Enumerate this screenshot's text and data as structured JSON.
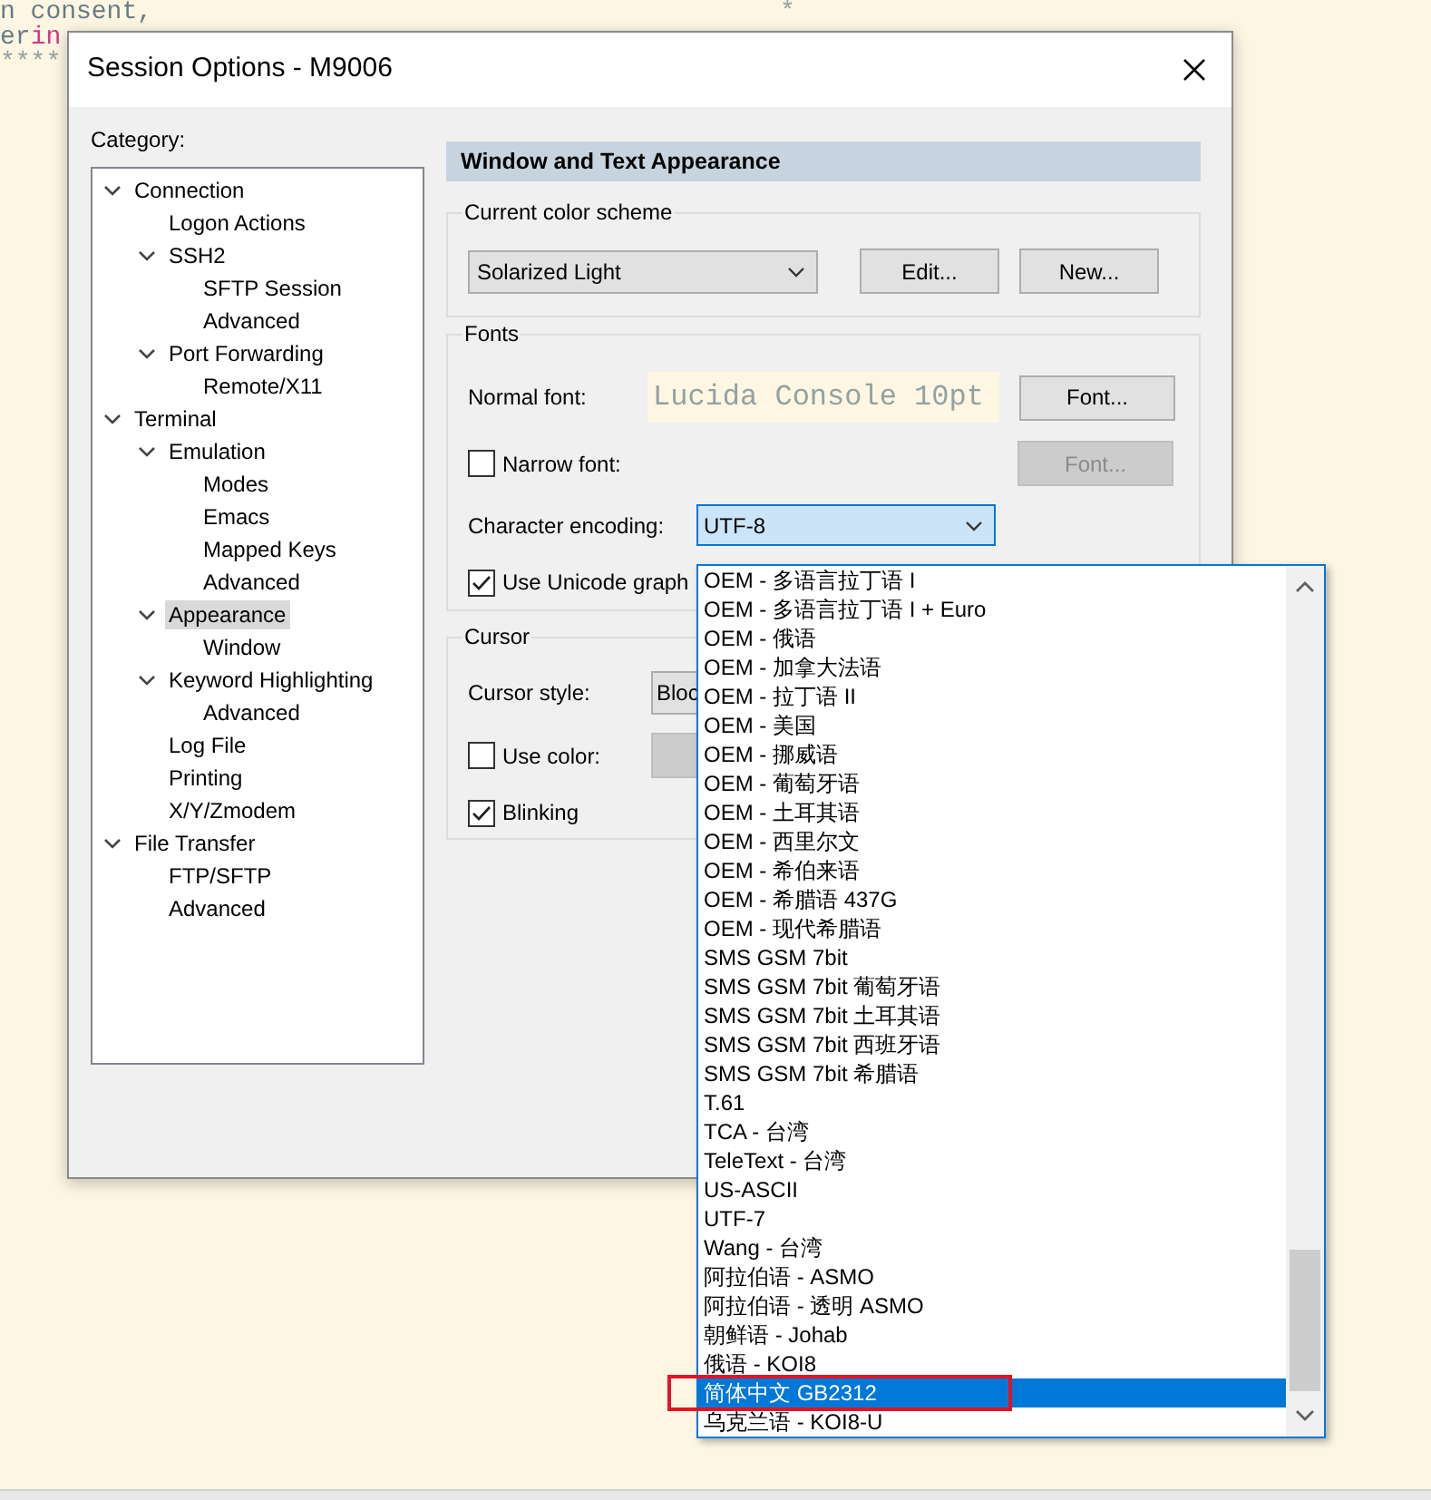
{
  "editor": {
    "lines": [
      {
        "segments": [
          {
            "text": "n consent,",
            "color": "#657b83"
          }
        ],
        "trail": "*"
      },
      {
        "segments": [
          {
            "text": "er",
            "color": "#657b83"
          },
          {
            "text": "in",
            "color": "#d33682"
          }
        ]
      },
      {
        "segments": [
          {
            "text": "****",
            "color": "#93a1a1"
          }
        ]
      }
    ]
  },
  "dialog": {
    "title": "Session Options - M9006"
  },
  "category_label": "Category:",
  "tree": [
    {
      "label": "Connection",
      "expanded": true,
      "selected": false,
      "children": [
        {
          "label": "Logon Actions",
          "selected": false
        },
        {
          "label": "SSH2",
          "expanded": true,
          "selected": false,
          "children": [
            {
              "label": "SFTP Session",
              "selected": false
            },
            {
              "label": "Advanced",
              "selected": false
            }
          ]
        },
        {
          "label": "Port Forwarding",
          "expanded": true,
          "selected": false,
          "children": [
            {
              "label": "Remote/X11",
              "selected": false
            }
          ]
        }
      ]
    },
    {
      "label": "Terminal",
      "expanded": true,
      "selected": false,
      "children": [
        {
          "label": "Emulation",
          "expanded": true,
          "selected": false,
          "children": [
            {
              "label": "Modes",
              "selected": false
            },
            {
              "label": "Emacs",
              "selected": false
            },
            {
              "label": "Mapped Keys",
              "selected": false
            },
            {
              "label": "Advanced",
              "selected": false
            }
          ]
        },
        {
          "label": "Appearance",
          "expanded": true,
          "selected": true,
          "children": [
            {
              "label": "Window",
              "selected": false
            }
          ]
        },
        {
          "label": "Keyword Highlighting",
          "expanded": true,
          "selected": false,
          "children": [
            {
              "label": "Advanced",
              "selected": false
            }
          ]
        },
        {
          "label": "Log File",
          "selected": false
        },
        {
          "label": "Printing",
          "selected": false
        },
        {
          "label": "X/Y/Zmodem",
          "selected": false
        }
      ]
    },
    {
      "label": "File Transfer",
      "expanded": true,
      "selected": false,
      "children": [
        {
          "label": "FTP/SFTP",
          "selected": false
        },
        {
          "label": "Advanced",
          "selected": false
        }
      ]
    }
  ],
  "panel": {
    "header": "Window and Text Appearance",
    "color_scheme": {
      "legend": "Current color scheme",
      "value": "Solarized Light",
      "buttons": [
        "Edit...",
        "New..."
      ]
    },
    "fonts": {
      "legend": "Fonts",
      "normal_font_label": "Normal font:",
      "normal_font_preview": "Lucida Console 10pt",
      "font_button": {
        "label": "Font...",
        "disabled": false
      },
      "narrow_font": {
        "label": "Narrow font:",
        "checked": false
      },
      "narrow_font_button": {
        "label": "Font...",
        "disabled": true
      },
      "encoding_label": "Character encoding:",
      "encoding_value": "UTF-8",
      "unicode_graphics": {
        "label": "Use Unicode graph",
        "checked": true
      }
    },
    "cursor": {
      "legend": "Cursor",
      "style_label": "Cursor style:",
      "style_value": "Bloc",
      "use_color": {
        "label": "Use color:",
        "checked": false
      },
      "color_button": {
        "disabled": true
      },
      "blinking": {
        "label": "Blinking",
        "checked": true
      }
    }
  },
  "encoding_list": {
    "items": [
      {
        "text": "OEM - 多语言拉丁语 I",
        "selected": false
      },
      {
        "text": "OEM - 多语言拉丁语 I + Euro",
        "selected": false
      },
      {
        "text": "OEM - 俄语",
        "selected": false
      },
      {
        "text": "OEM - 加拿大法语",
        "selected": false
      },
      {
        "text": "OEM - 拉丁语 II",
        "selected": false
      },
      {
        "text": "OEM - 美国",
        "selected": false
      },
      {
        "text": "OEM - 挪威语",
        "selected": false
      },
      {
        "text": "OEM - 葡萄牙语",
        "selected": false
      },
      {
        "text": "OEM - 土耳其语",
        "selected": false
      },
      {
        "text": "OEM - 西里尔文",
        "selected": false
      },
      {
        "text": "OEM - 希伯来语",
        "selected": false
      },
      {
        "text": "OEM - 希腊语 437G",
        "selected": false
      },
      {
        "text": "OEM - 现代希腊语",
        "selected": false
      },
      {
        "text": "SMS GSM 7bit",
        "selected": false
      },
      {
        "text": "SMS GSM 7bit 葡萄牙语",
        "selected": false
      },
      {
        "text": "SMS GSM 7bit 土耳其语",
        "selected": false
      },
      {
        "text": "SMS GSM 7bit 西班牙语",
        "selected": false
      },
      {
        "text": "SMS GSM 7bit 希腊语",
        "selected": false
      },
      {
        "text": "T.61",
        "selected": false
      },
      {
        "text": "TCA - 台湾",
        "selected": false
      },
      {
        "text": "TeleText - 台湾",
        "selected": false
      },
      {
        "text": "US-ASCII",
        "selected": false
      },
      {
        "text": "UTF-7",
        "selected": false
      },
      {
        "text": "Wang - 台湾",
        "selected": false
      },
      {
        "text": "阿拉伯语 - ASMO",
        "selected": false
      },
      {
        "text": "阿拉伯语 - 透明 ASMO",
        "selected": false
      },
      {
        "text": "朝鲜语 - Johab",
        "selected": false
      },
      {
        "text": "俄语 - KOI8",
        "selected": false
      },
      {
        "text": "简体中文 GB2312",
        "selected": true
      },
      {
        "text": "乌克兰语 - KOI8-U",
        "selected": false
      }
    ]
  }
}
